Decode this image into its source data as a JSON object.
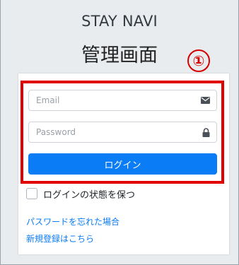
{
  "brand": "STAY NAVI",
  "subtitle": "管理画面",
  "annotation": "①",
  "form": {
    "email_placeholder": "Email",
    "email_value": "",
    "password_placeholder": "Password",
    "password_value": "",
    "login_label": "ログイン",
    "remember_label": "ログインの状態を保つ",
    "remember_checked": false
  },
  "links": {
    "forgot_password": "パスワードを忘れた場合",
    "register": "新規登録はこちら"
  },
  "icons": {
    "email": "envelope-icon",
    "password": "lock-icon"
  },
  "colors": {
    "primary": "#0a7cf5",
    "highlight": "#e00000",
    "background": "#e9ecef"
  }
}
